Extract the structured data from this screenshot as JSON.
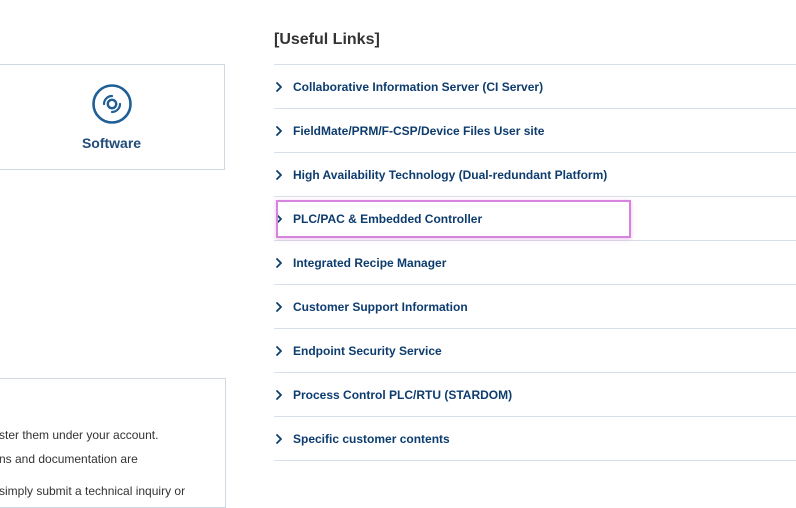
{
  "software_card": {
    "label": "Software",
    "icon": "disc-icon"
  },
  "info_card": {
    "line1": "ster them under your account.",
    "line2": "ns and documentation are",
    "line3": "simply submit a technical inquiry or"
  },
  "useful_links": {
    "heading": "[Useful Links]",
    "items": [
      {
        "label": "Collaborative Information Server (CI Server)"
      },
      {
        "label": "FieldMate/PRM/F-CSP/Device Files User site"
      },
      {
        "label": "High Availability Technology (Dual-redundant Platform)"
      },
      {
        "label": "PLC/PAC & Embedded Controller"
      },
      {
        "label": "Integrated Recipe Manager"
      },
      {
        "label": "Customer Support Information"
      },
      {
        "label": "Endpoint Security Service"
      },
      {
        "label": "Process Control PLC/RTU (STARDOM)"
      },
      {
        "label": "Specific customer contents"
      }
    ]
  },
  "colors": {
    "link_text": "#0d3c6e",
    "heading_text": "#333333",
    "highlight_border": "#d784df",
    "divider": "#d9dfe6"
  }
}
